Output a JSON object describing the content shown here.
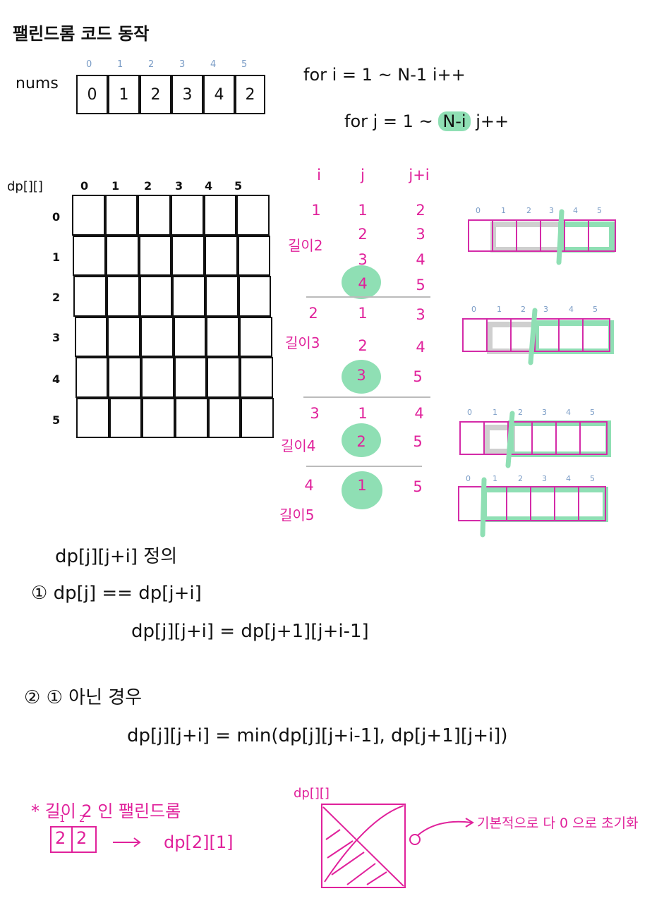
{
  "title": "팰린드롬 코드 동작",
  "nums": {
    "label": "nums",
    "indices": [
      "0",
      "1",
      "2",
      "3",
      "4",
      "5"
    ],
    "values": [
      "0",
      "1",
      "2",
      "3",
      "4",
      "2"
    ]
  },
  "loops": {
    "outer": "for i = 1 ~ N-1   i++",
    "inner_prefix": "for j = 1 ~ ",
    "inner_highlight": "N-i",
    "inner_suffix": "  j++"
  },
  "dp_grid": {
    "label": "dp[][]",
    "col_labels": [
      "0",
      "1",
      "2",
      "3",
      "4",
      "5"
    ],
    "row_labels": [
      "0",
      "1",
      "2",
      "3",
      "4",
      "5"
    ]
  },
  "table": {
    "headers": [
      "i",
      "j",
      "j+i"
    ],
    "groups": [
      {
        "length_label": "길이2",
        "rows": [
          [
            "1",
            "1",
            "2"
          ],
          [
            "",
            "2",
            "3"
          ],
          [
            "",
            "3",
            "4"
          ],
          [
            "",
            "4",
            "5"
          ]
        ]
      },
      {
        "length_label": "길이3",
        "rows": [
          [
            "2",
            "1",
            "3"
          ],
          [
            "",
            "2",
            "4"
          ],
          [
            "",
            "3",
            "5"
          ]
        ]
      },
      {
        "length_label": "길이4",
        "rows": [
          [
            "3",
            "1",
            "4"
          ],
          [
            "",
            "2",
            "5"
          ]
        ]
      },
      {
        "length_label": "길이5",
        "rows": [
          [
            "4",
            "1",
            "5"
          ]
        ]
      }
    ]
  },
  "mini_arrays": {
    "indices": [
      "0",
      "1",
      "2",
      "3",
      "4",
      "5"
    ]
  },
  "definition": {
    "heading": "dp[j][j+i] 정의",
    "case1_cond": "① dp[j] == dp[j+i]",
    "case1_expr": "dp[j][j+i] = dp[j+1][j+i-1]",
    "case2_cond": "② ① 아닌 경우",
    "case2_expr": "dp[j][j+i] = min(dp[j][j+i-1], dp[j+1][j+i])"
  },
  "footnote": {
    "star_title": "* 길이 2 인   팰린드롬",
    "pair_indices": [
      "1",
      "2"
    ],
    "pair_values": [
      "2",
      "2"
    ],
    "pair_result": "dp[2][1]",
    "dp_label": "dp[][]",
    "init_note": "기본적으로  다 0 으로 초기화"
  },
  "colors": {
    "ink": "#111111",
    "pink": "#e0219b",
    "green": "#8fdfb4",
    "index_blue": "#7a9cc6",
    "gray": "#bbbbbb"
  }
}
